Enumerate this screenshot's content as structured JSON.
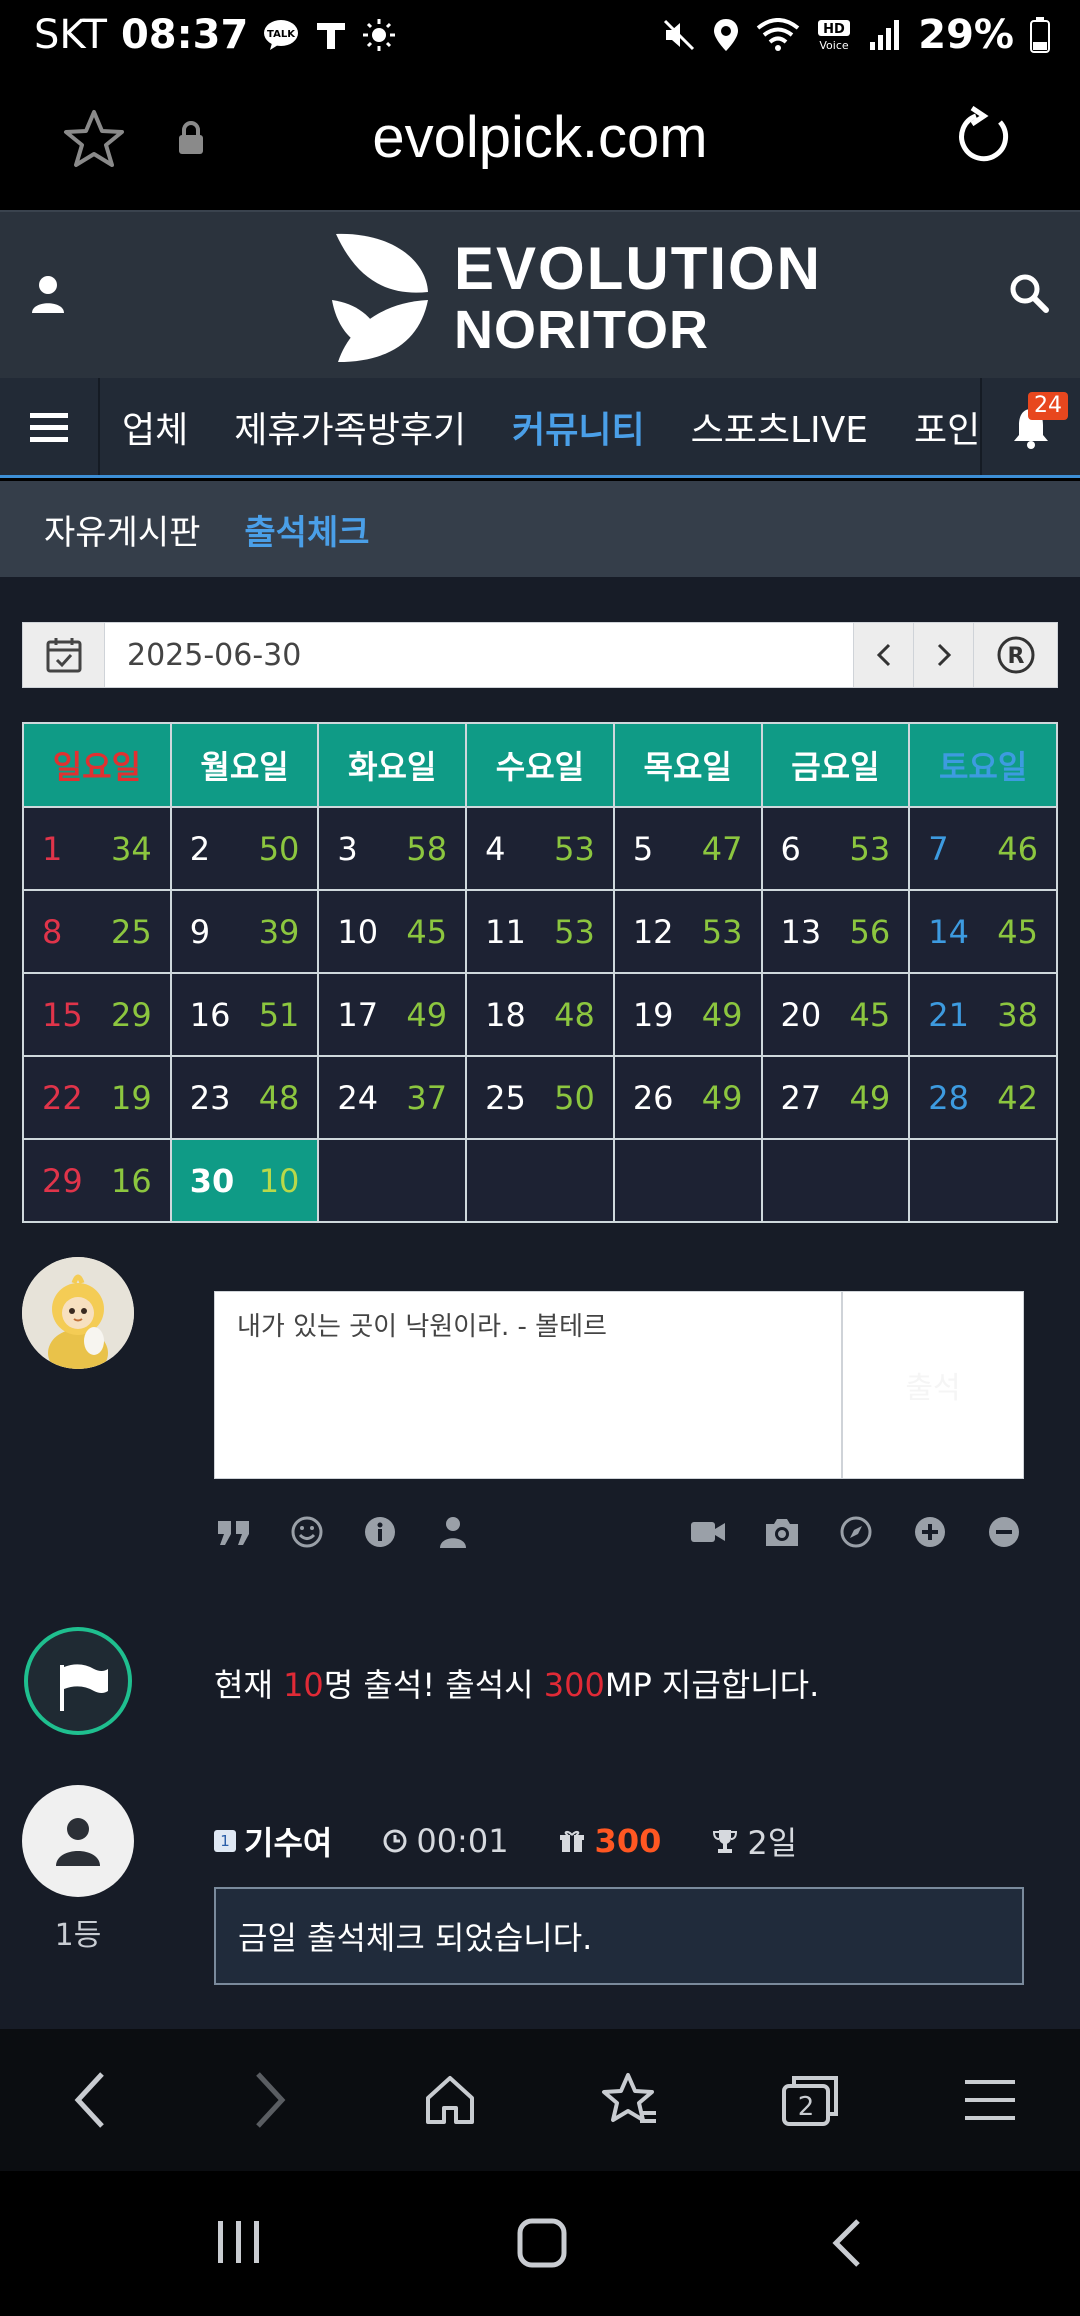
{
  "status_bar": {
    "carrier": "SKT",
    "time": "08:37",
    "battery": "29%",
    "talk_badge": "TALK",
    "hd_voice": "HD Voice"
  },
  "browser": {
    "url": "evolpick.com"
  },
  "site": {
    "logo_line1": "EVOLUTION",
    "logo_line2": "NORITOR",
    "logo_reg": "®"
  },
  "nav": {
    "items": [
      "업체",
      "제휴가족방후기",
      "커뮤니티",
      "스포츠LIVE",
      "포인트전"
    ],
    "active_index": 2,
    "notification_count": "24"
  },
  "sub_nav": {
    "items": [
      "자유게시판",
      "출석체크"
    ],
    "active_index": 1
  },
  "date_picker": {
    "value": "2025-06-30",
    "prev": "‹",
    "next": "›",
    "reset": "®"
  },
  "calendar": {
    "headers": [
      "일요일",
      "월요일",
      "화요일",
      "수요일",
      "목요일",
      "금요일",
      "토요일"
    ],
    "weeks": [
      [
        [
          1,
          34
        ],
        [
          2,
          50
        ],
        [
          3,
          58
        ],
        [
          4,
          53
        ],
        [
          5,
          47
        ],
        [
          6,
          53
        ],
        [
          7,
          46
        ]
      ],
      [
        [
          8,
          25
        ],
        [
          9,
          39
        ],
        [
          10,
          45
        ],
        [
          11,
          53
        ],
        [
          12,
          53
        ],
        [
          13,
          56
        ],
        [
          14,
          45
        ]
      ],
      [
        [
          15,
          29
        ],
        [
          16,
          51
        ],
        [
          17,
          49
        ],
        [
          18,
          48
        ],
        [
          19,
          49
        ],
        [
          20,
          45
        ],
        [
          21,
          38
        ]
      ],
      [
        [
          22,
          19
        ],
        [
          23,
          48
        ],
        [
          24,
          37
        ],
        [
          25,
          50
        ],
        [
          26,
          49
        ],
        [
          27,
          49
        ],
        [
          28,
          42
        ]
      ],
      [
        [
          29,
          16
        ],
        [
          30,
          10
        ],
        null,
        null,
        null,
        null,
        null
      ]
    ],
    "today": 30
  },
  "comment": {
    "text": "내가 있는 곳이 낙원이라. - 볼테르",
    "submit_label": "출석"
  },
  "attendance": {
    "prefix": "현재 ",
    "count": "10",
    "mid": "명 출석! 출석시 ",
    "points": "300",
    "suffix": "MP 지급합니다."
  },
  "entry": {
    "level": "1",
    "name": "기수여",
    "time": "00:01",
    "points": "300",
    "days": "2일",
    "rank": "1등",
    "message": "금일 출석체크 되었습니다."
  },
  "colors": {
    "teal": "#0f9b86",
    "accent_blue": "#4a9fe8",
    "red": "#e02a36",
    "green_count": "#8cc63f",
    "orange_points": "#ff5722"
  }
}
